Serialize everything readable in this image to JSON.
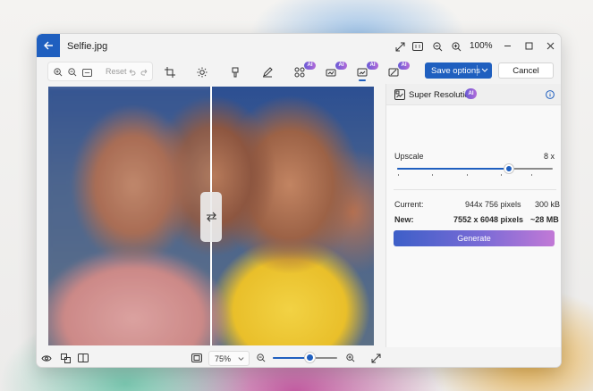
{
  "window": {
    "file_name": "Selfie.jpg",
    "zoom_level": "100%"
  },
  "toolbar": {
    "reset_label": "Reset",
    "save_label": "Save options",
    "cancel_label": "Cancel",
    "ai_badge": "AI",
    "tools": [
      "crop-icon",
      "brightness-icon",
      "erase-icon",
      "markup-icon",
      "background-blur-icon",
      "generative-fill-icon",
      "super-resolution-icon",
      "restyle-icon"
    ]
  },
  "panel": {
    "title": "Super Resolution",
    "ai_badge": "AI",
    "upscale_label": "Upscale",
    "upscale_value": "8 x",
    "upscale_level": 0.72,
    "current_label": "Current:",
    "current_dims": "944x 756 pixels",
    "current_size": "300 kB",
    "new_label": "New:",
    "new_dims": "7552 x 6048 pixels",
    "new_size": "~28 MB",
    "generate_label": "Generate"
  },
  "bottombar": {
    "zoom_select_value": "75%",
    "zoom_slider_level": 0.58
  },
  "colors": {
    "accent": "#1f5fbf",
    "generate_gradient_start": "#3d5fc8",
    "generate_gradient_end": "#c279d6"
  }
}
